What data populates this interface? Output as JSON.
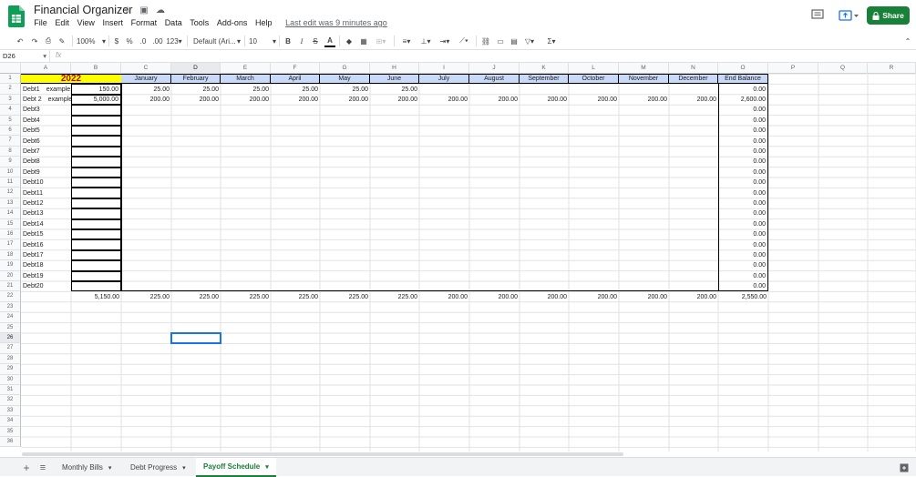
{
  "header": {
    "doc_title": "Financial Organizer",
    "menu": [
      "File",
      "Edit",
      "View",
      "Insert",
      "Format",
      "Data",
      "Tools",
      "Add-ons",
      "Help"
    ],
    "last_edit": "Last edit was 9 minutes ago",
    "share_label": "Share"
  },
  "toolbar": {
    "zoom": "100%",
    "currency": "$",
    "percent": "%",
    "dec_decrease": ".0",
    "dec_increase": ".00",
    "more_formats": "123",
    "font": "Default (Ari...",
    "font_size": "10",
    "bold": "B",
    "italic": "I",
    "strike": "S",
    "text_color": "A"
  },
  "formula_bar": {
    "cell_ref": "D26",
    "fx": "fx"
  },
  "columns": [
    "A",
    "B",
    "C",
    "D",
    "E",
    "F",
    "G",
    "H",
    "I",
    "J",
    "K",
    "L",
    "M",
    "N",
    "O",
    "P",
    "Q",
    "R"
  ],
  "selected_column": "D",
  "selected_row": 26,
  "rows": 36,
  "sheet": {
    "year": "2022",
    "year_highlight": "#ffff00",
    "header_fill": "#c9daf8",
    "months": [
      "January",
      "February",
      "March",
      "April",
      "May",
      "June",
      "July",
      "August",
      "September",
      "October",
      "November",
      "December",
      "End Balance"
    ],
    "debts": [
      {
        "name": "Debt1",
        "note": "example",
        "start": "150.00",
        "pay": [
          "25.00",
          "25.00",
          "25.00",
          "25.00",
          "25.00",
          "25.00",
          "",
          "",
          "",
          "",
          "",
          ""
        ],
        "end": "0.00"
      },
      {
        "name": "Debt 2",
        "note": "example",
        "start": "5,000.00",
        "pay": [
          "200.00",
          "200.00",
          "200.00",
          "200.00",
          "200.00",
          "200.00",
          "200.00",
          "200.00",
          "200.00",
          "200.00",
          "200.00",
          "200.00"
        ],
        "end": "2,600.00"
      },
      {
        "name": "Debt3",
        "note": "",
        "start": "",
        "pay": [],
        "end": "0.00"
      },
      {
        "name": "Debt4",
        "note": "",
        "start": "",
        "pay": [],
        "end": "0.00"
      },
      {
        "name": "Debt5",
        "note": "",
        "start": "",
        "pay": [],
        "end": "0.00"
      },
      {
        "name": "Debt6",
        "note": "",
        "start": "",
        "pay": [],
        "end": "0.00"
      },
      {
        "name": "Debt7",
        "note": "",
        "start": "",
        "pay": [],
        "end": "0.00"
      },
      {
        "name": "Debt8",
        "note": "",
        "start": "",
        "pay": [],
        "end": "0.00"
      },
      {
        "name": "Debt9",
        "note": "",
        "start": "",
        "pay": [],
        "end": "0.00"
      },
      {
        "name": "Debt10",
        "note": "",
        "start": "",
        "pay": [],
        "end": "0.00"
      },
      {
        "name": "Debt11",
        "note": "",
        "start": "",
        "pay": [],
        "end": "0.00"
      },
      {
        "name": "Debt12",
        "note": "",
        "start": "",
        "pay": [],
        "end": "0.00"
      },
      {
        "name": "Debt13",
        "note": "",
        "start": "",
        "pay": [],
        "end": "0.00"
      },
      {
        "name": "Debt14",
        "note": "",
        "start": "",
        "pay": [],
        "end": "0.00"
      },
      {
        "name": "Debt15",
        "note": "",
        "start": "",
        "pay": [],
        "end": "0.00"
      },
      {
        "name": "Debt16",
        "note": "",
        "start": "",
        "pay": [],
        "end": "0.00"
      },
      {
        "name": "Debt17",
        "note": "",
        "start": "",
        "pay": [],
        "end": "0.00"
      },
      {
        "name": "Debt18",
        "note": "",
        "start": "",
        "pay": [],
        "end": "0.00"
      },
      {
        "name": "Debt19",
        "note": "",
        "start": "",
        "pay": [],
        "end": "0.00"
      },
      {
        "name": "Debt20",
        "note": "",
        "start": "",
        "pay": [],
        "end": "0.00"
      }
    ],
    "totals": {
      "start": "5,150.00",
      "months": [
        "225.00",
        "225.00",
        "225.00",
        "225.00",
        "225.00",
        "225.00",
        "200.00",
        "200.00",
        "200.00",
        "200.00",
        "200.00",
        "200.00"
      ],
      "end": "2,550.00"
    }
  },
  "tabs": [
    {
      "label": "Monthly Bills",
      "active": false
    },
    {
      "label": "Debt Progress",
      "active": false
    },
    {
      "label": "Payoff Schedule",
      "active": true
    }
  ]
}
